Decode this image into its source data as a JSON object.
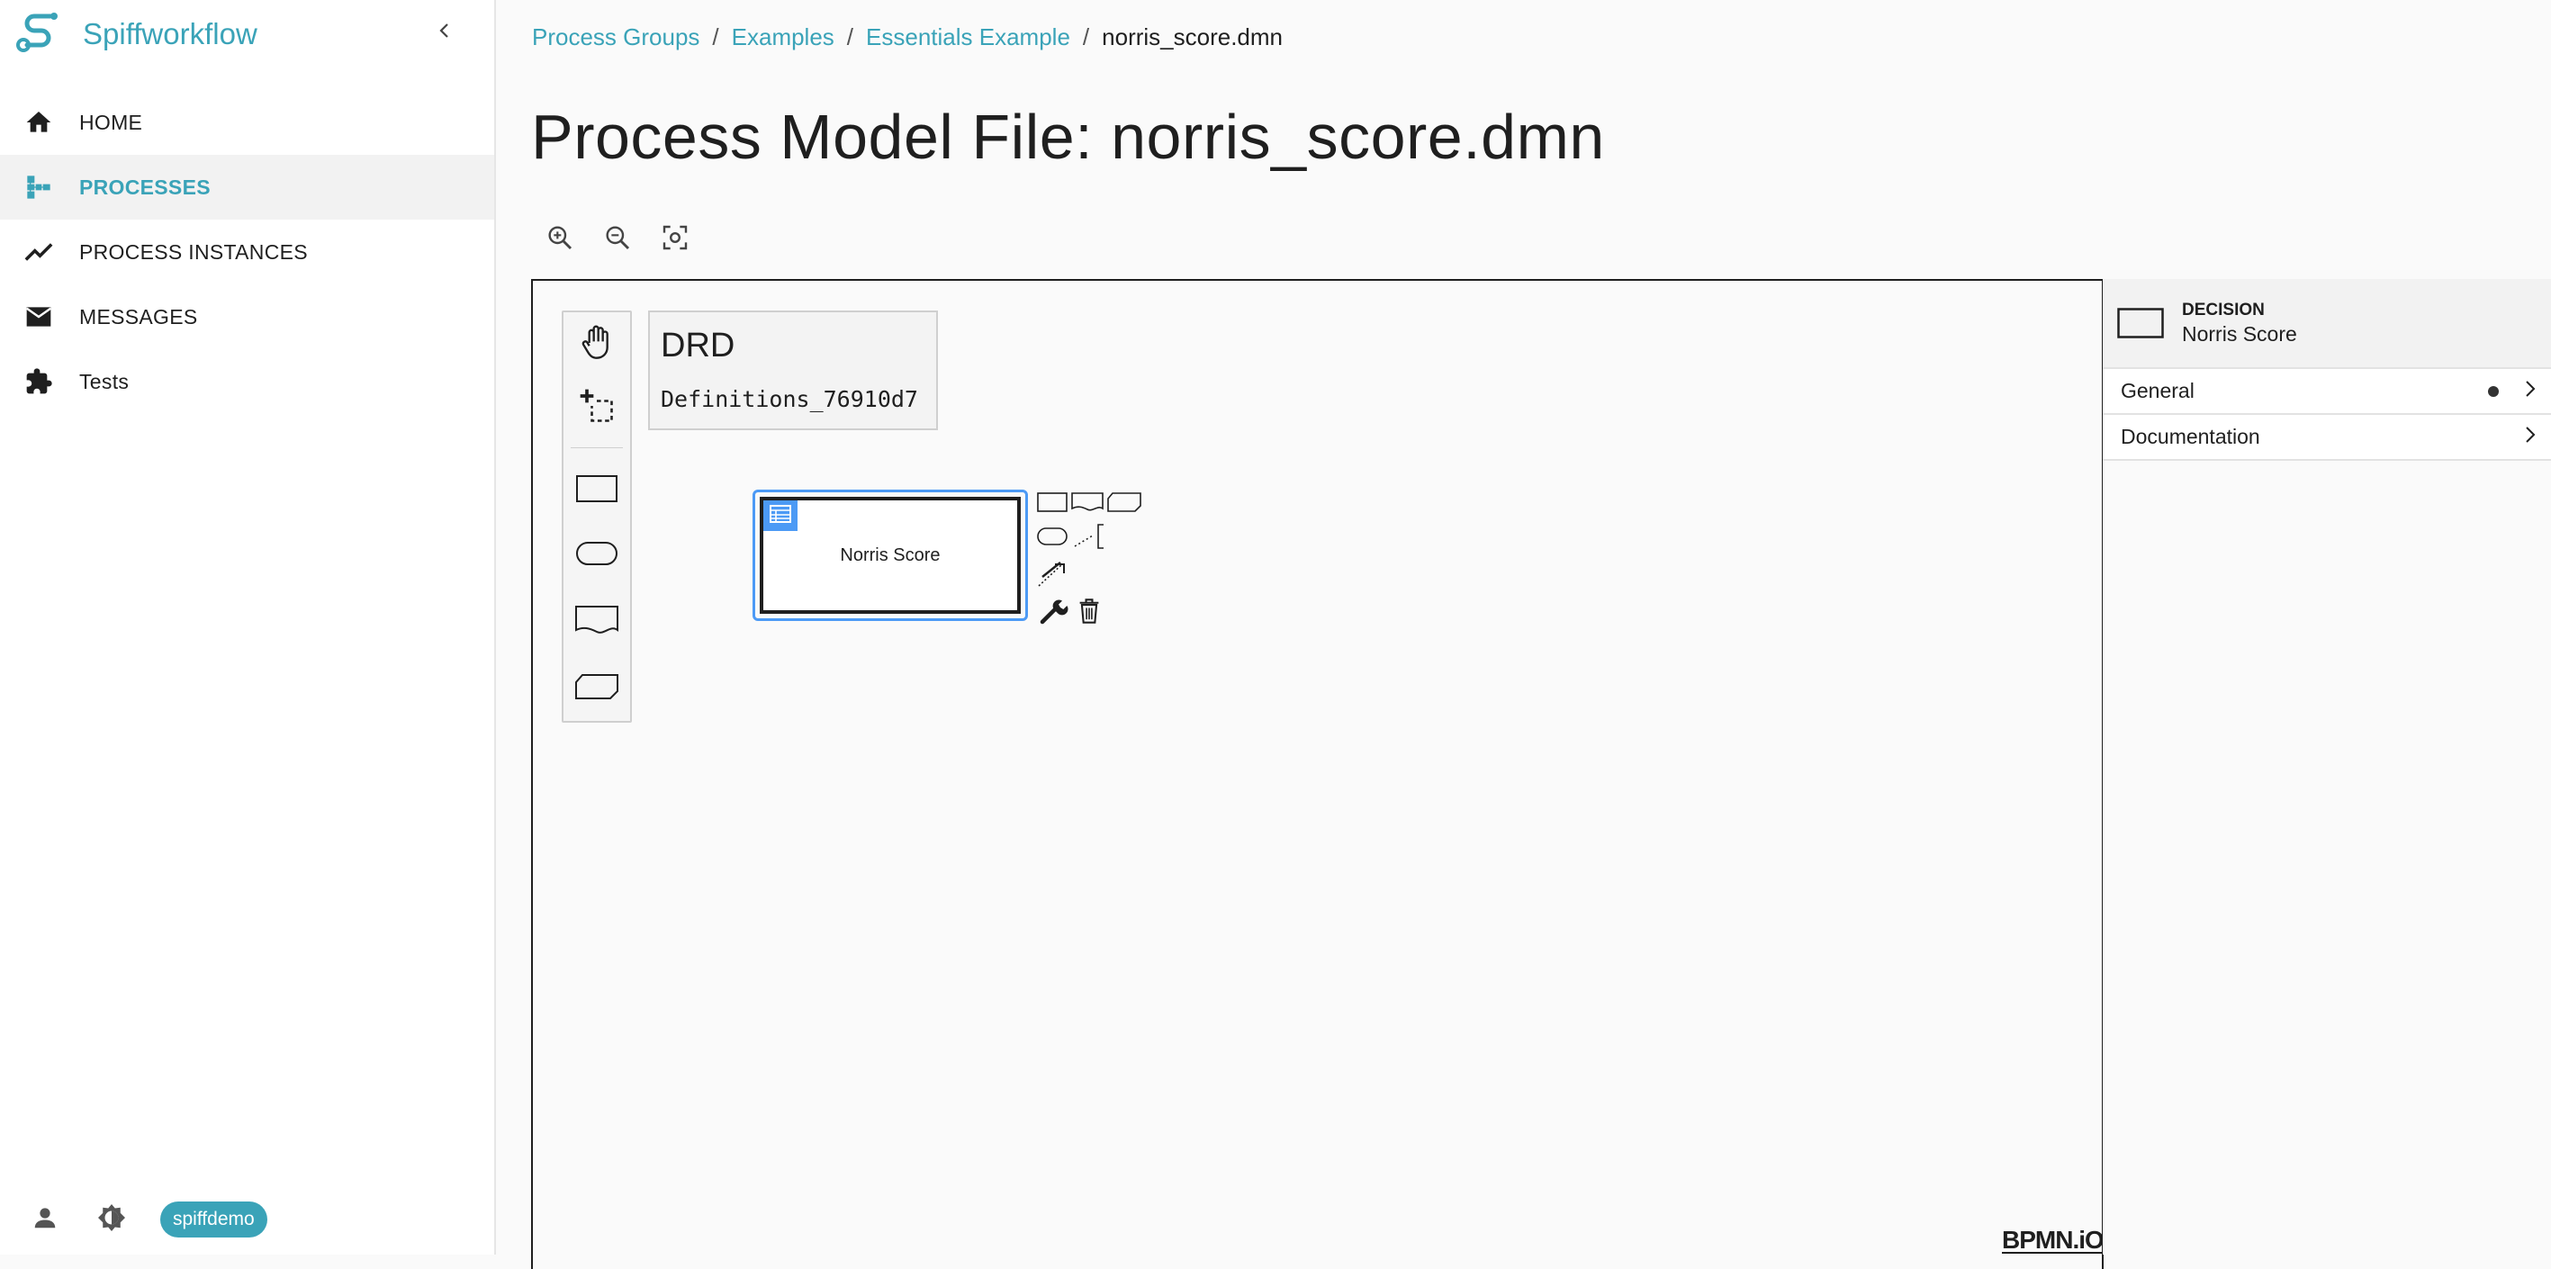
{
  "app": {
    "name": "Spiffworkflow"
  },
  "sidebar": {
    "items": [
      {
        "label": "HOME",
        "icon": "home-icon",
        "active": false
      },
      {
        "label": "PROCESSES",
        "icon": "process-tree-icon",
        "active": true
      },
      {
        "label": "PROCESS INSTANCES",
        "icon": "trending-line-icon",
        "active": false
      },
      {
        "label": "MESSAGES",
        "icon": "envelope-icon",
        "active": false
      },
      {
        "label": "Tests",
        "icon": "puzzle-icon",
        "active": false
      }
    ],
    "footer": {
      "username": "spiffdemo"
    }
  },
  "breadcrumb": {
    "items": [
      "Process Groups",
      "Examples",
      "Essentials Example"
    ],
    "current": "norris_score.dmn"
  },
  "page": {
    "title": "Process Model File: norris_score.dmn"
  },
  "editor": {
    "drd_title": "DRD",
    "definitions_id": "Definitions_76910d7",
    "decision_label": "Norris Score",
    "watermark": "BPMN.iO"
  },
  "properties": {
    "element_type": "DECISION",
    "element_name": "Norris Score",
    "groups": [
      {
        "label": "General",
        "has_entries": true
      },
      {
        "label": "Documentation",
        "has_entries": false
      }
    ]
  },
  "colors": {
    "accent": "#3aa3b8",
    "selection": "#4c9af5",
    "text": "#1f1f1f"
  }
}
